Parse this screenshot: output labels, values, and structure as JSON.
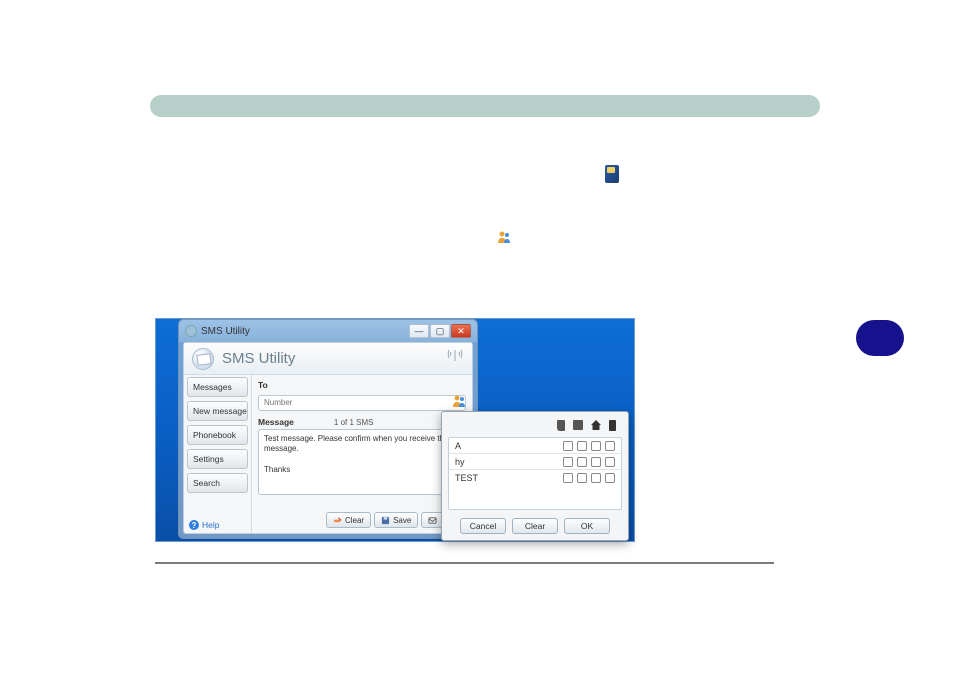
{
  "window": {
    "title": "SMS Utility",
    "app_title": "SMS Utility"
  },
  "sidebar": {
    "items": [
      {
        "label": "Messages"
      },
      {
        "label": "New message"
      },
      {
        "label": "Phonebook"
      },
      {
        "label": "Settings"
      },
      {
        "label": "Search"
      }
    ],
    "help_label": "Help"
  },
  "compose": {
    "to_label": "To",
    "to_placeholder": "Number",
    "message_label": "Message",
    "count_text": "1 of 1 SMS",
    "body": "Test message. Please confirm when you receive this message.\n\nThanks"
  },
  "actions": {
    "clear": "Clear",
    "save": "Save",
    "send": "Send"
  },
  "picker": {
    "rows": [
      {
        "name": "A"
      },
      {
        "name": "hy"
      },
      {
        "name": "TEST"
      }
    ],
    "cancel": "Cancel",
    "clear": "Clear",
    "ok": "OK"
  }
}
